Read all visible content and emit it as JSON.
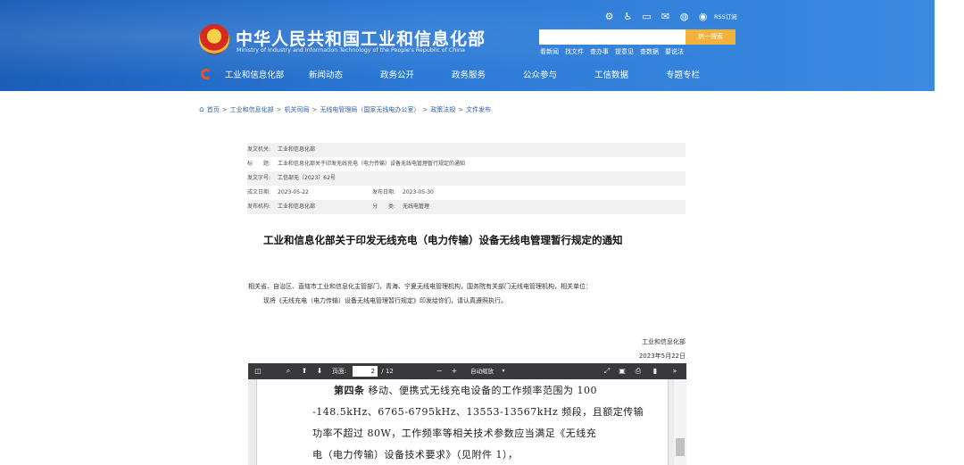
{
  "header": {
    "title": "中华人民共和国工业和信息化部",
    "subtitle": "Ministry of Industry and Information Technology of the People's Republic of China",
    "utility_icons": [
      "settings-icon",
      "accessibility-icon",
      "monitor-icon",
      "mail-icon",
      "wechat-icon",
      "weibo-icon"
    ],
    "rss_label": "RSS订阅",
    "search_placeholder": "",
    "search_button": "统一搜索",
    "quick_links": [
      "看新闻",
      "找文件",
      "查办事",
      "提意见",
      "查数据",
      "要说法"
    ],
    "nav": [
      "工业和信息化部",
      "新闻动态",
      "政务公开",
      "政务服务",
      "公众参与",
      "工信数据",
      "专题专栏"
    ]
  },
  "breadcrumb": [
    "首页",
    "工业和信息化部",
    "机关司局",
    "无线电管理局（国家无线电办公室）",
    "政策法规",
    "文件发布"
  ],
  "meta": {
    "issuer_label": "发文机关:",
    "issuer": "工业和信息化部",
    "title_label": "标　　题:",
    "title": "工业和信息化部关于印发无线充电（电力传输）设备无线电管理暂行规定的通知",
    "doc_no_label": "发文字号:",
    "doc_no": "工信部无〔2023〕62号",
    "written_label": "成文日期:",
    "written": "2023-05-22",
    "published_label": "发布日期:",
    "published": "2023-05-30",
    "org_label": "发布机构:",
    "org": "工业和信息化部",
    "category_label": "分　　类:",
    "category": "无线电管理"
  },
  "article": {
    "title": "工业和信息化部关于印发无线充电（电力传输）设备无线电管理暂行规定的通知",
    "recipients": "相关省、自治区、直辖市工业和信息化主管部门，青海、宁夏无线电管理机构，国务院有关部门无线电管理机构，相关单位：",
    "body": "现将《无线充电（电力传输）设备无线电管理暂行规定》印发给你们，请认真遵照执行。",
    "signature": "工业和信息化部",
    "date": "2023年5月22日"
  },
  "viewer": {
    "find_label": "页面:",
    "current_page": "2",
    "total_pages": "/ 12",
    "zoom": "自动缩放",
    "lines": [
      {
        "bold": "第四条",
        "text": "  移动、便携式无线充电设备的工作频率范围为 100"
      },
      {
        "bold": "",
        "text": "-148.5kHz、6765-6795kHz、13553-13567kHz 频段，且额定传输"
      },
      {
        "bold": "",
        "text": "功率不超过 80W，工作频率等相关技术参数应当满足《无线充"
      },
      {
        "bold": "",
        "text": "电（电力传输）设备技术要求》（见附件 1），"
      }
    ]
  }
}
